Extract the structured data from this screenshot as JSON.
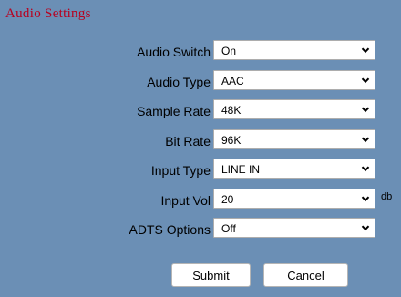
{
  "title": "Audio Settings",
  "fields": [
    {
      "label": "Audio Switch",
      "value": "On"
    },
    {
      "label": "Audio Type",
      "value": "AAC"
    },
    {
      "label": "Sample Rate",
      "value": "48K"
    },
    {
      "label": "Bit Rate",
      "value": "96K"
    },
    {
      "label": "Input Type",
      "value": "LINE IN"
    },
    {
      "label": "Input Vol",
      "value": "20",
      "unit": "db"
    },
    {
      "label": "ADTS Options",
      "value": "Off"
    }
  ],
  "buttons": {
    "submit": "Submit",
    "cancel": "Cancel"
  },
  "icons": {
    "select_arrow": "chevron-down-icon"
  },
  "colors": {
    "background": "#6b8fb5",
    "title": "#b8001f"
  }
}
